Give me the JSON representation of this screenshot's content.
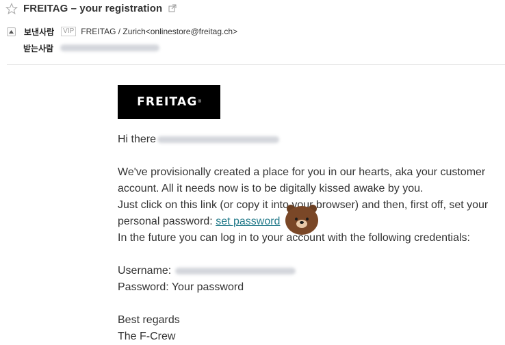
{
  "header": {
    "subject": "FREITAG – your registration",
    "icons": [
      "star-icon",
      "external-link-icon"
    ]
  },
  "meta": {
    "from_label": "보낸사람",
    "vip_badge": "VIP",
    "from_value": "FREITAG / Zurich<onlinestore@freitag.ch>",
    "to_label": "받는사람"
  },
  "email": {
    "logo_text": "FREITAG",
    "logo_mark": "®",
    "greeting": "Hi there",
    "paragraph_line1": "We've provisionally created a place for you in our hearts, aka your customer",
    "paragraph_line2": "account. All it needs now is to be digitally kissed awake by you.",
    "paragraph_line3": "Just click on this link (or copy it into your browser) and then, first off, set your",
    "paragraph_line4_prefix": "personal password: ",
    "link_text": "set password",
    "paragraph_line5": "In the future you can log in to your account with the following credentials:",
    "username_label": "Username:",
    "password_line": "Password: Your password",
    "closing": "Best regards",
    "signature": "The F-Crew"
  },
  "colors": {
    "link": "#237a8a",
    "logo_bg": "#000000",
    "text": "#333333"
  }
}
